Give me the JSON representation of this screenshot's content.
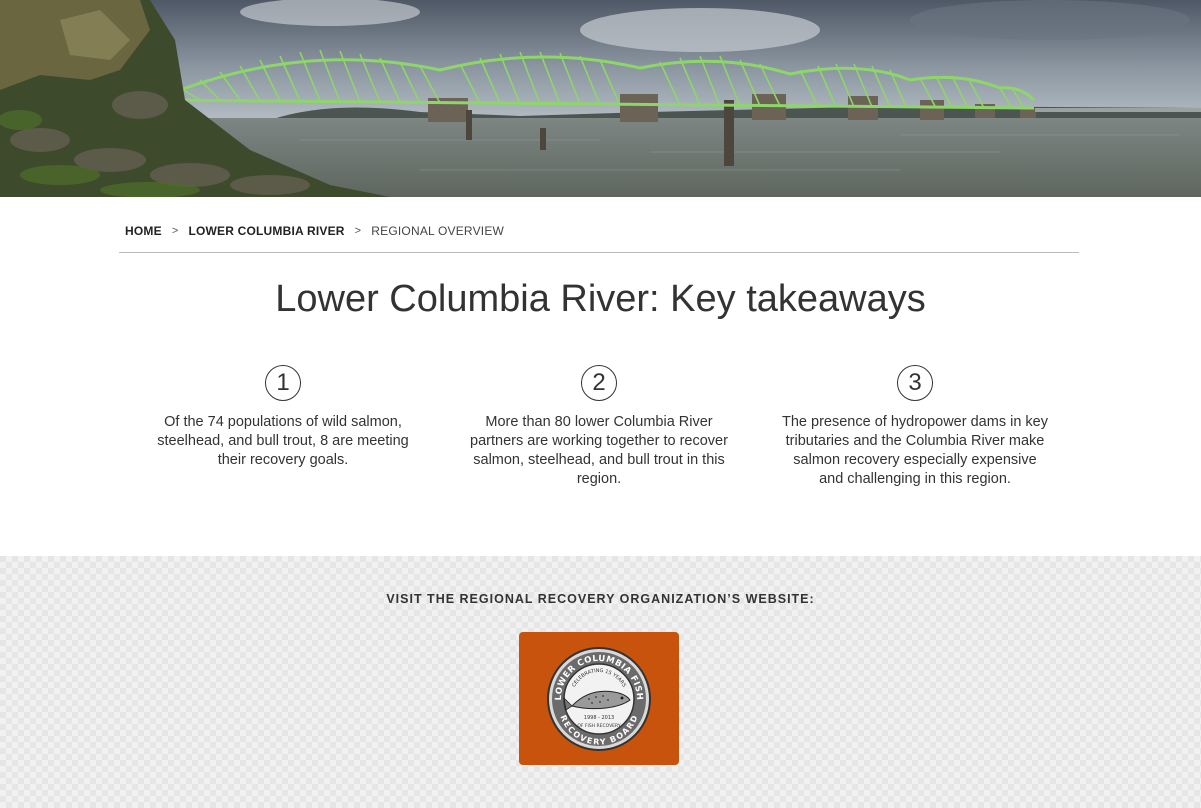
{
  "breadcrumb": {
    "home": "HOME",
    "region": "LOWER COLUMBIA RIVER",
    "current": "REGIONAL OVERVIEW",
    "separator": ">"
  },
  "title": "Lower Columbia River: Key takeaways",
  "takeaways": [
    {
      "number": "1",
      "text": "Of the 74 populations of wild salmon, steelhead, and bull trout, 8 are meeting their recovery goals."
    },
    {
      "number": "2",
      "text": "More than 80 lower Columbia River partners are working together to recover salmon, steelhead, and bull trout in this region."
    },
    {
      "number": "3",
      "text": "The presence of hydropower dams in key tributaries and the Columbia River make salmon recovery especially expensive and challenging in this region."
    }
  ],
  "footer": {
    "visit_label": "VISIT THE REGIONAL RECOVERY ORGANIZATION’S WEBSITE:",
    "logo": {
      "top_text": "LOWER COLUMBIA FISH",
      "bottom_text": "RECOVERY BOARD",
      "celebrating": "CELEBRATING 15 YEARS",
      "years": "1998 - 2013",
      "of_fish": "OF FISH RECOVERY",
      "icon": "salmon-icon",
      "background_color": "#c8530d"
    }
  },
  "colors": {
    "bridge": "#8ed66a",
    "text": "#333333"
  }
}
